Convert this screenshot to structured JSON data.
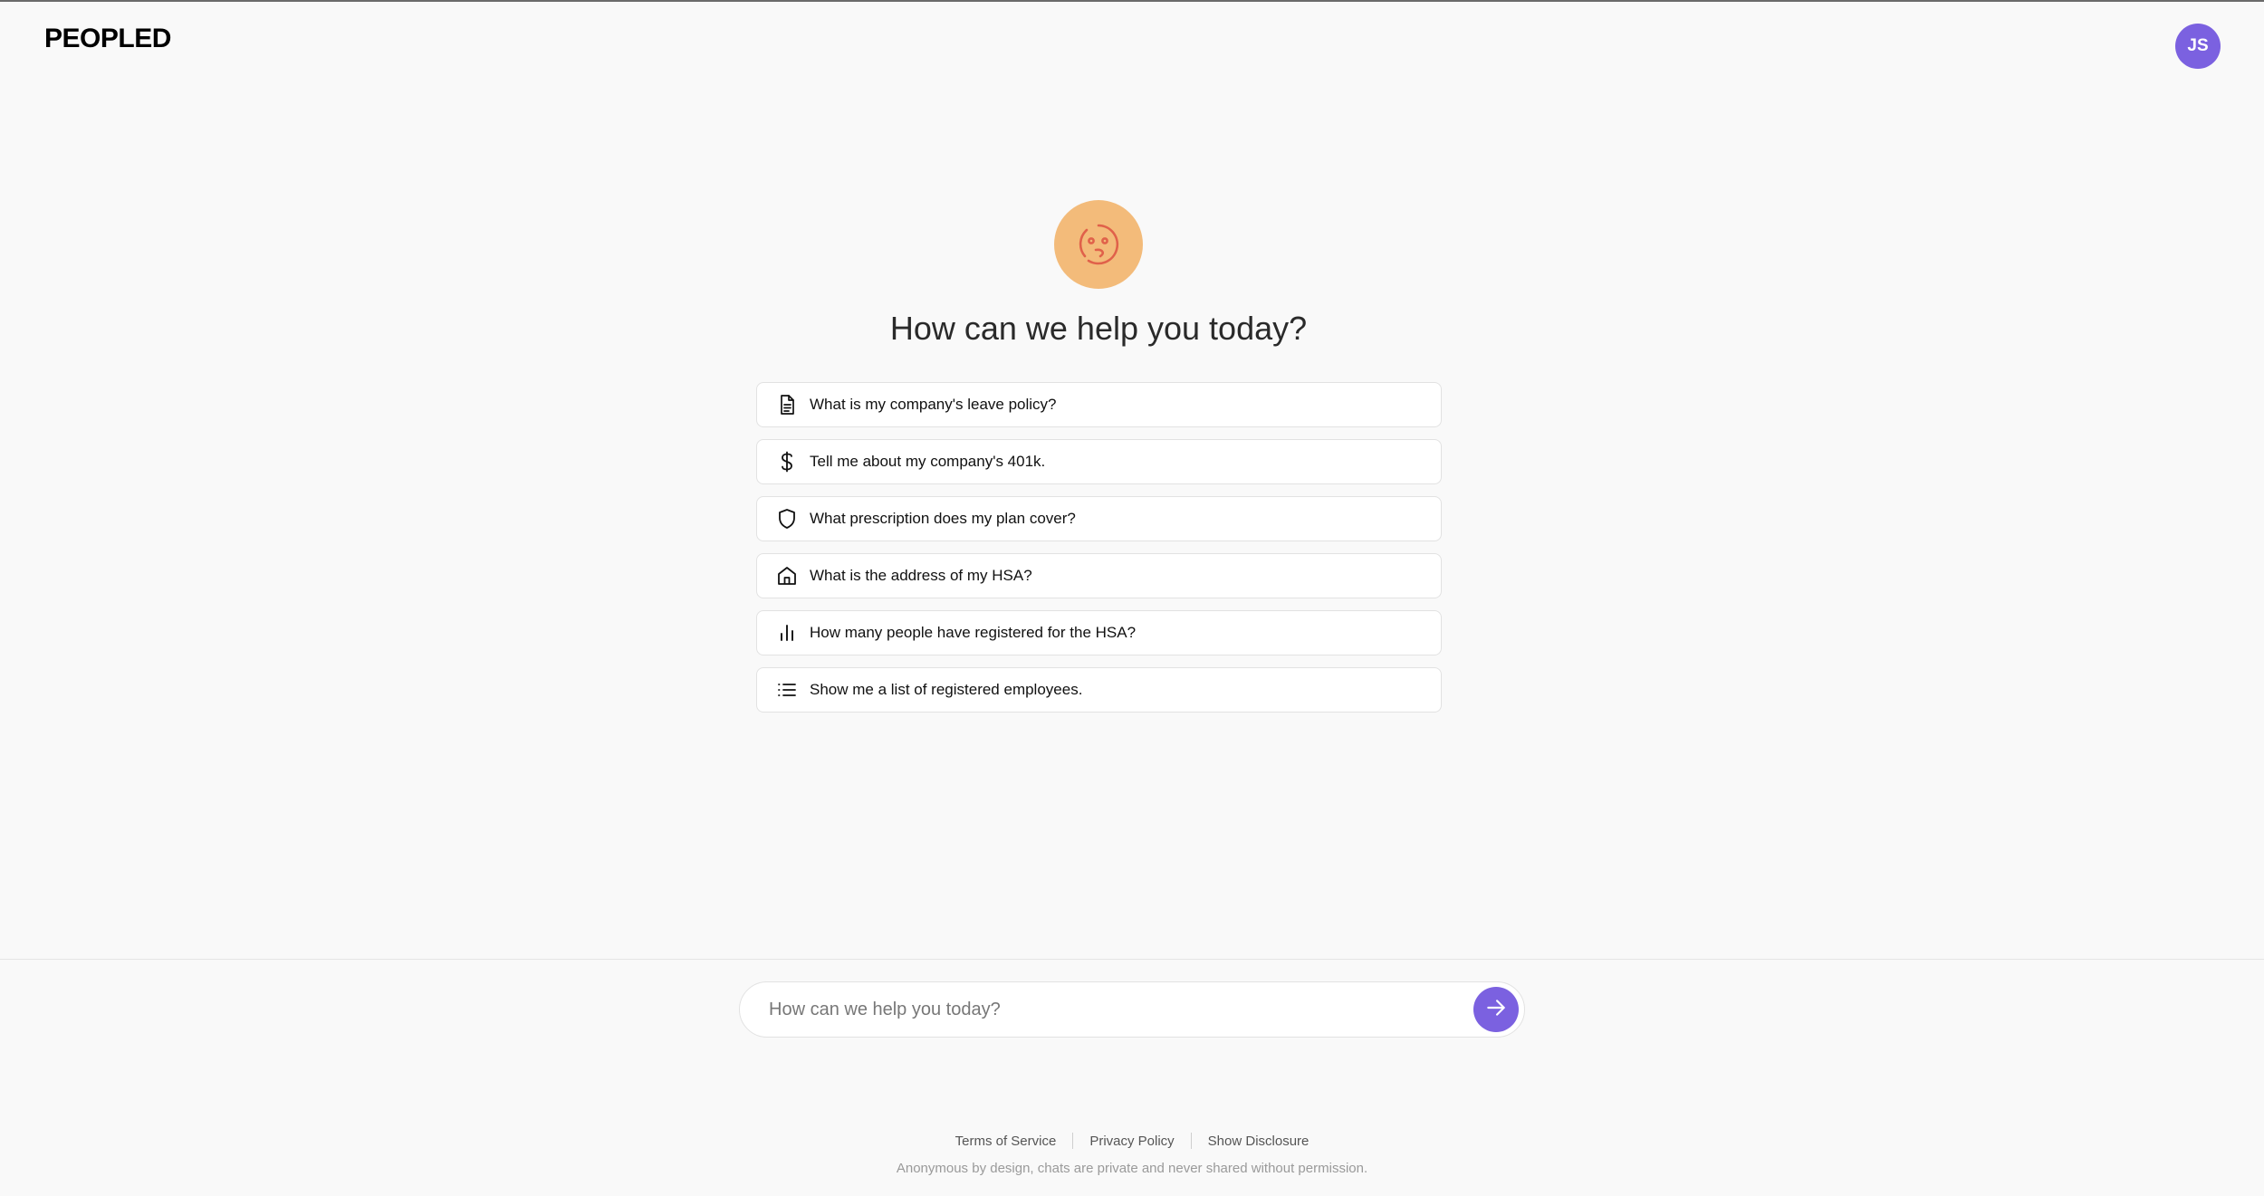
{
  "header": {
    "logo": "PEOPLED",
    "avatar_initials": "JS"
  },
  "hero": {
    "icon": "confused-face-icon",
    "title": "How can we help you today?"
  },
  "suggestions": [
    {
      "icon": "document-icon",
      "label": "What is my company's leave policy?"
    },
    {
      "icon": "dollar-icon",
      "label": "Tell me about my company's 401k."
    },
    {
      "icon": "shield-icon",
      "label": "What prescription does my plan cover?"
    },
    {
      "icon": "home-icon",
      "label": "What is the address of my HSA?"
    },
    {
      "icon": "bar-chart-icon",
      "label": "How many people have registered for the HSA?"
    },
    {
      "icon": "list-icon",
      "label": "Show me a list of registered employees."
    }
  ],
  "chat": {
    "placeholder": "How can we help you today?",
    "value": "",
    "send_icon": "arrow-right-icon"
  },
  "footer": {
    "links": [
      "Terms of Service",
      "Privacy Policy",
      "Show Disclosure"
    ],
    "note": "Anonymous by design, chats are private and never shared without permission."
  },
  "colors": {
    "accent": "#7b61e0",
    "hero_bg": "#f3bb7a",
    "hero_face": "#e0614a",
    "page_bg": "#f9f9f9"
  }
}
